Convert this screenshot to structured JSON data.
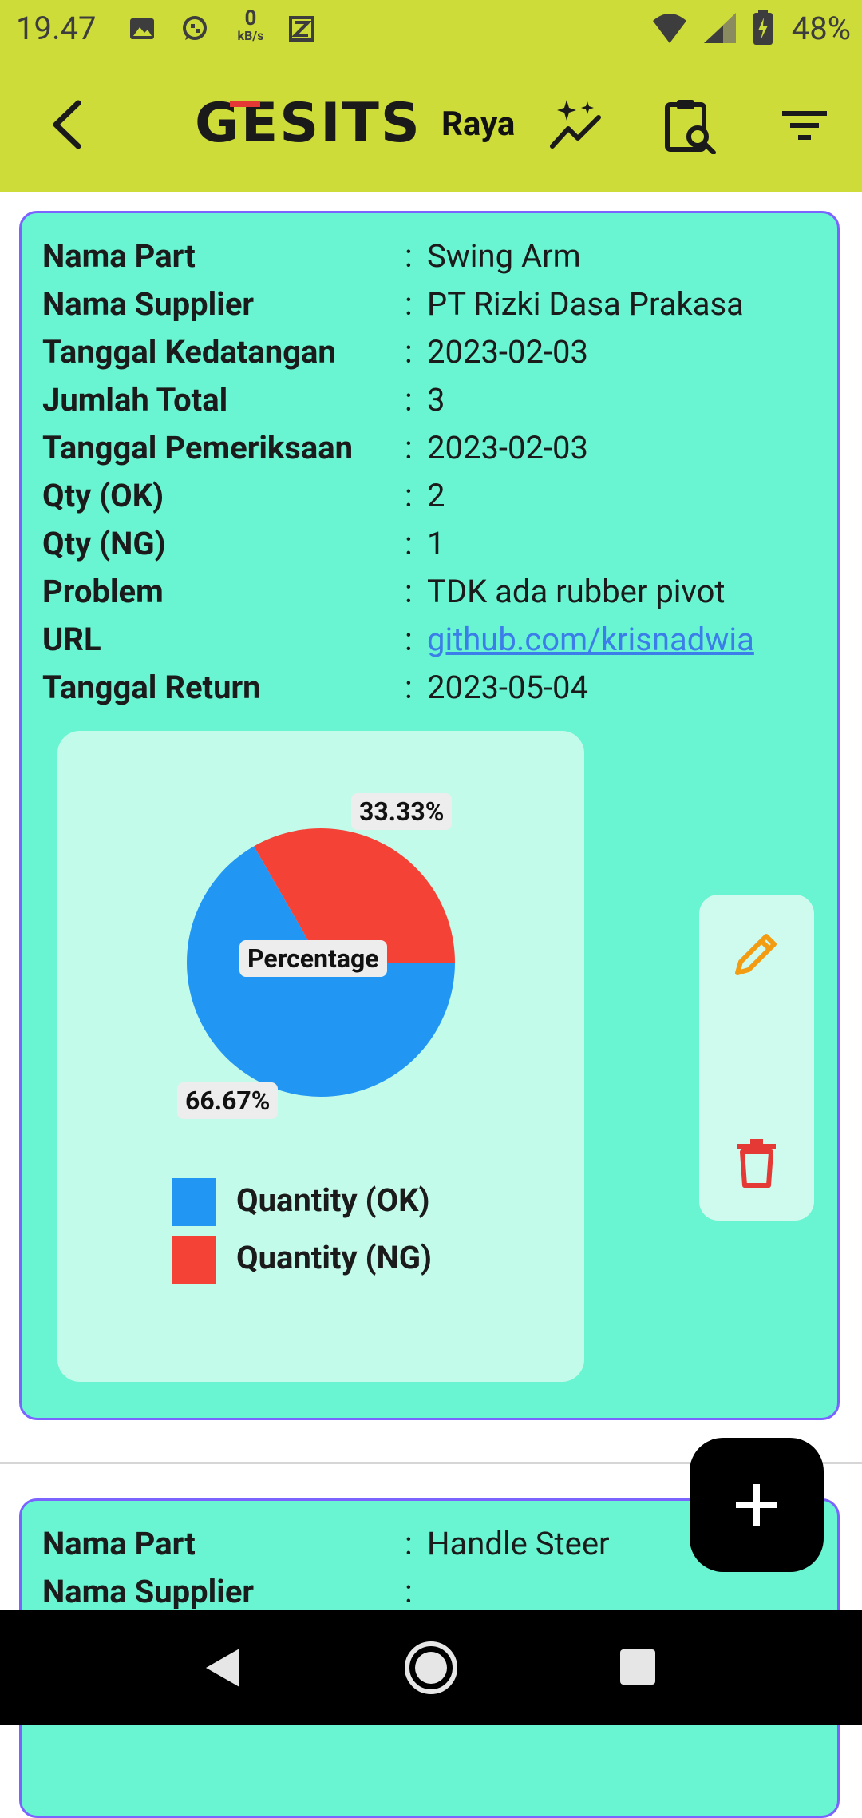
{
  "status_bar": {
    "time": "19.47",
    "net_speed_value": "0",
    "net_speed_unit": "kB/s",
    "battery": "48%",
    "icons": [
      "image-icon",
      "whatsapp-icon",
      "net-speed-icon",
      "app-z-icon",
      "wifi-icon",
      "signal-icon",
      "battery-icon"
    ]
  },
  "app_bar": {
    "logo": "GESITS",
    "model": "Raya",
    "icons": [
      "back-arrow-icon",
      "sparkle-chart-icon",
      "clipboard-search-icon",
      "filter-icon"
    ],
    "accent_color": "#cddc39"
  },
  "cards": [
    {
      "rows": [
        {
          "label": "Nama Part",
          "value": "Swing Arm"
        },
        {
          "label": "Nama Supplier",
          "value": "PT Rizki Dasa Prakasa"
        },
        {
          "label": "Tanggal Kedatangan",
          "value": "2023-02-03"
        },
        {
          "label": "Jumlah Total",
          "value": "3"
        },
        {
          "label": "Tanggal Pemeriksaan",
          "value": "2023-02-03"
        },
        {
          "label": "Qty (OK)",
          "value": "2"
        },
        {
          "label": "Qty (NG)",
          "value": "1"
        },
        {
          "label": "Problem",
          "value": "TDK ada rubber pivot"
        },
        {
          "label": "URL",
          "value": "github.com/krisnadwia"
        },
        {
          "label": "Tanggal Return",
          "value": "2023-05-04"
        }
      ],
      "colon": ":",
      "actions": {
        "edit_icon": "pencil-icon",
        "delete_icon": "trash-icon"
      }
    },
    {
      "rows": [
        {
          "label": "Nama Part",
          "value": "Handle Steer"
        },
        {
          "label": "Nama Supplier",
          "value": ""
        }
      ],
      "colon": ":"
    }
  ],
  "chart_data": {
    "type": "pie",
    "title": "Percentage",
    "categories": [
      "Quantity (OK)",
      "Quantity (NG)"
    ],
    "values": [
      66.67,
      33.33
    ],
    "labels": [
      "66.67%",
      "33.33%"
    ],
    "colors": [
      "#2196f3",
      "#f44336"
    ],
    "legend": "bottom"
  },
  "fab": {
    "icon": "plus-icon"
  },
  "nav_bar": {
    "icons": [
      "back-triangle-icon",
      "home-circle-icon",
      "recents-square-icon"
    ]
  }
}
